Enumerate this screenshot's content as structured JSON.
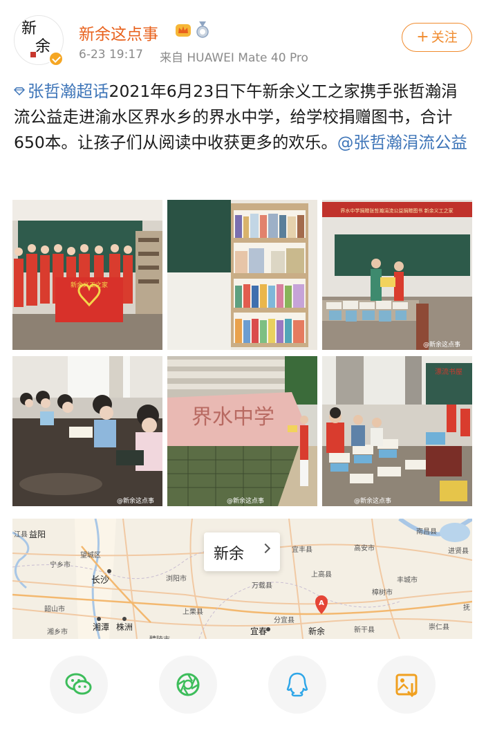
{
  "post": {
    "user_name": "新余这点事",
    "avatar_text_1": "新",
    "avatar_text_2": "余",
    "time": "6-23 19:17",
    "source": "来自 HUAWEI Mate 40 Pro",
    "follow_label": "关注",
    "follow_plus": "+",
    "topic": "张哲瀚超话",
    "body": "2021年6月23日下午新余义工之家携手张哲瀚涓流公益走进渝水区界水乡的界水中学，给学校捐赠图书，合计650本。让孩子们从阅读中收获更多的欢乐。",
    "mention": "@张哲瀚涓流公益"
  },
  "photos": {
    "banner_text": "新余义工之家",
    "school_sign": "界水中学",
    "room_banner": "界水中学捐赠张哲瀚涓流公益捐赠图书  新余义工之家",
    "wall_sign": "漂流书屋",
    "watermark": "@新余这点事"
  },
  "map": {
    "callout": "新余",
    "labels": [
      "江县",
      "益阳",
      "望城区",
      "宁乡市",
      "长沙",
      "浏阳市",
      "韶山市",
      "湘潭",
      "株洲",
      "湘乡市",
      "上栗县",
      "醴陵市",
      "宜丰县",
      "高安市",
      "南昌县",
      "进贤县",
      "上高县",
      "丰城市",
      "万载县",
      "樟树市",
      "抚",
      "分宜县",
      "宜春",
      "新余",
      "新干县",
      "崇仁县"
    ],
    "marker_letter": "A"
  },
  "share": {
    "items": [
      "wechat-icon",
      "moments-icon",
      "qq-icon",
      "save-image-icon"
    ]
  },
  "colors": {
    "accent": "#e8611c",
    "link": "#3e75b8",
    "follow": "#f08a2c"
  }
}
